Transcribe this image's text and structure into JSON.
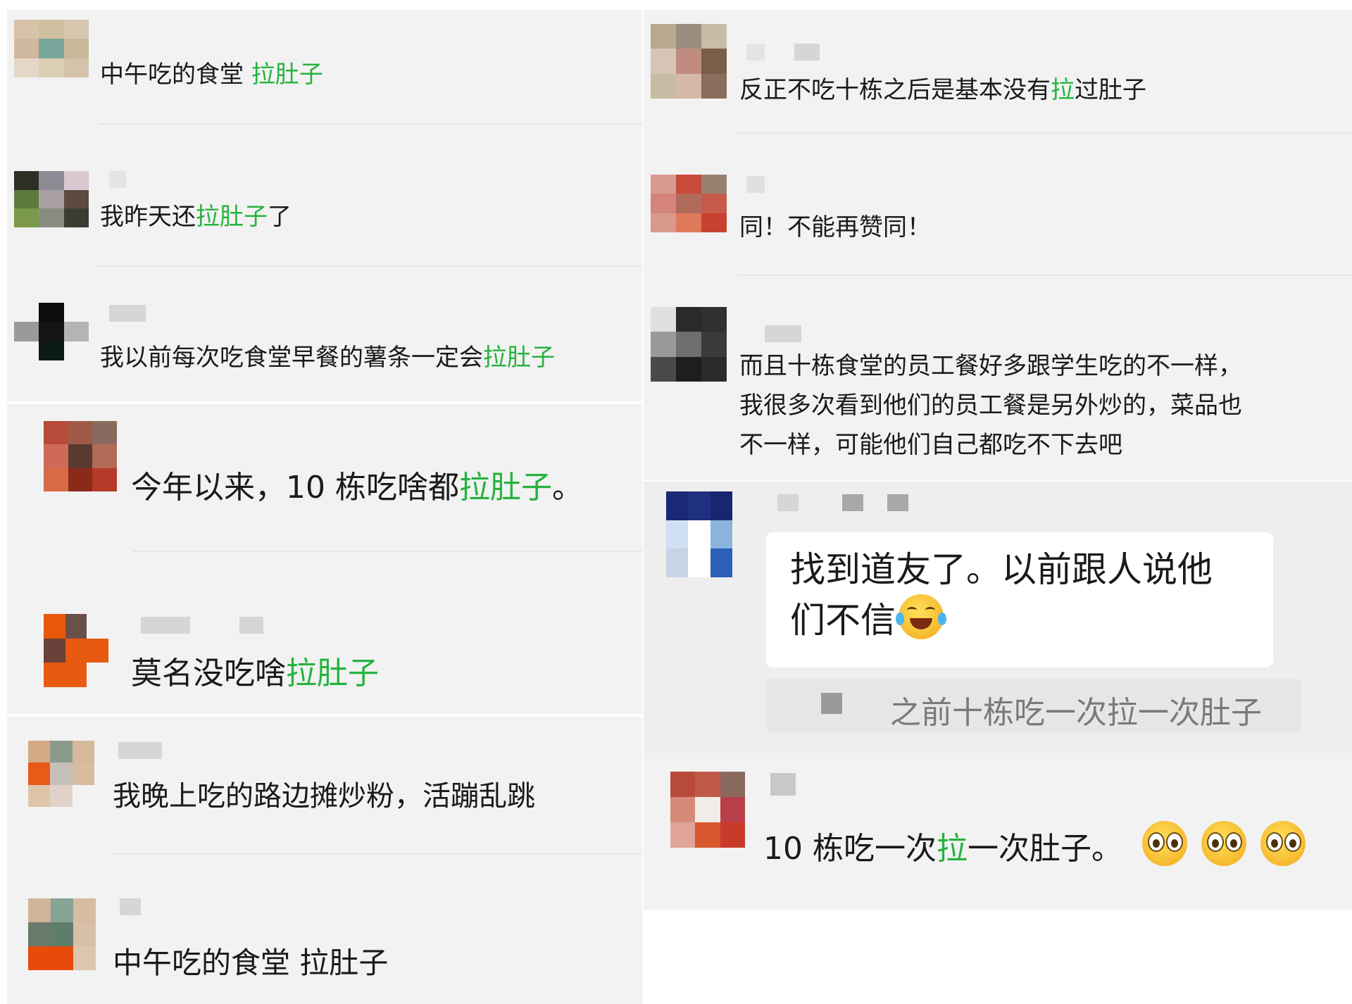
{
  "comments_left": [
    {
      "prefix": "中午吃的食堂 ",
      "highlight": "拉肚子",
      "suffix": ""
    },
    {
      "prefix": "我昨天还",
      "highlight": "拉肚子",
      "suffix": "了"
    },
    {
      "prefix": "我以前每次吃食堂早餐的薯条一定会",
      "highlight": "拉肚子",
      "suffix": ""
    },
    {
      "prefix": "今年以来，10 栋吃啥都",
      "highlight": "拉肚子",
      "suffix": "。"
    },
    {
      "prefix": "莫名没吃啥",
      "highlight": "拉肚子",
      "suffix": ""
    },
    {
      "prefix": "我晚上吃的路边摊炒粉，活蹦乱跳",
      "highlight": "",
      "suffix": ""
    },
    {
      "prefix": "中午吃的食堂 拉肚子",
      "highlight": "",
      "suffix": ""
    }
  ],
  "comments_right": [
    {
      "prefix": "反正不吃十栋之后是基本没有",
      "highlight": "拉",
      "suffix": "过肚子"
    },
    {
      "prefix": "同！不能再赞同！",
      "highlight": "",
      "suffix": ""
    },
    {
      "lines": [
        "而且十栋食堂的员工餐好多跟学生吃的不一样，",
        "我很多次看到他们的员工餐是另外炒的，菜品也",
        "不一样，可能他们自己都吃不下去吧"
      ]
    },
    {
      "lines": [
        "找到道友了。以前跟人说他",
        "们不信"
      ],
      "emoji": "tears-of-joy-emoji",
      "quote": "之前十栋吃一次拉一次肚子"
    },
    {
      "prefix": "10 栋吃一次",
      "highlight": "拉",
      "suffix": "一次肚子。",
      "emoji": "upside-down-pleading-emoji",
      "emoji_count": 3
    }
  ],
  "colors": {
    "panel_bg": "#f2f2f2",
    "highlight": "#25b33f",
    "bubble_bg": "#ffffff",
    "quote_bg": "#e6e6e6"
  }
}
